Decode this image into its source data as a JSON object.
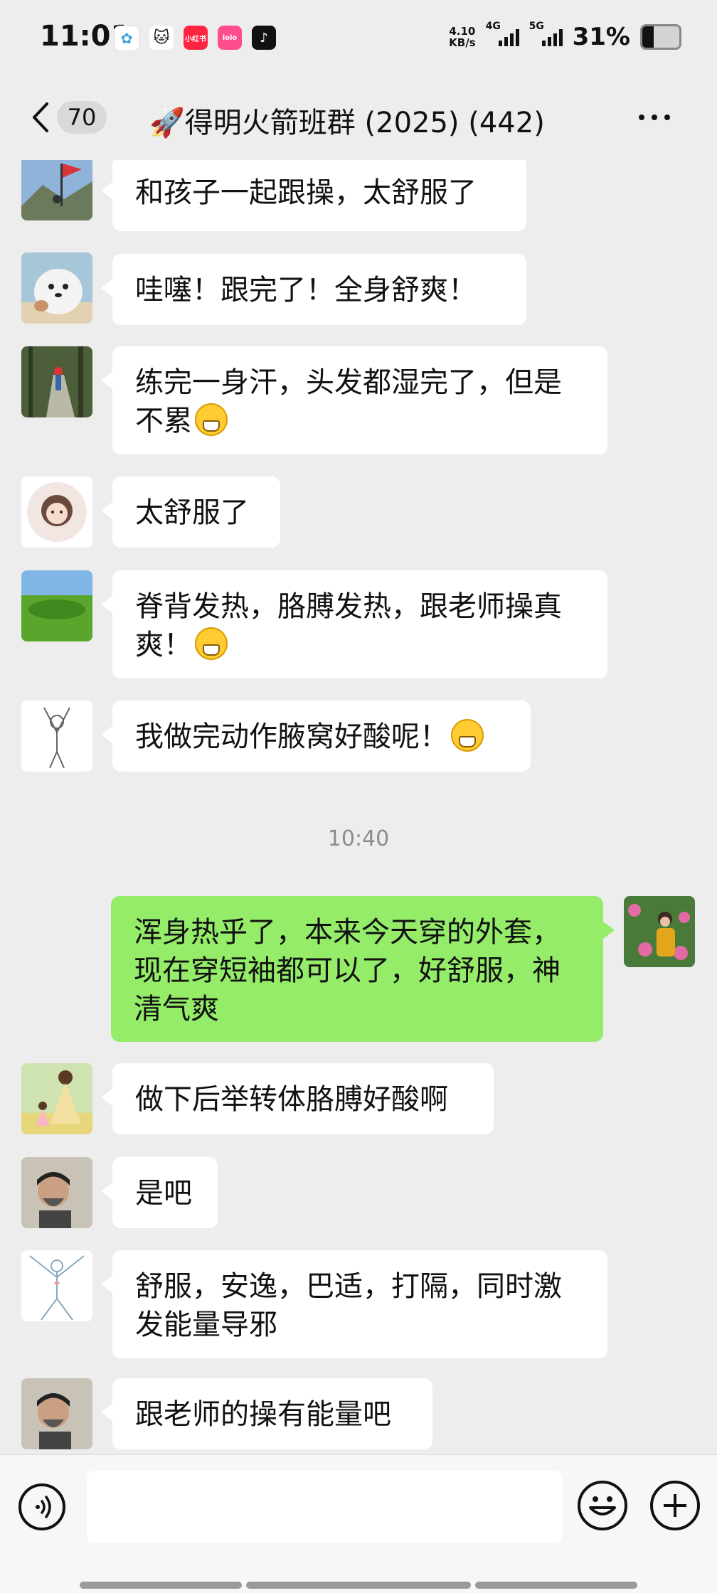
{
  "status_bar": {
    "time": "11:01",
    "net_speed_value": "4.10",
    "net_speed_unit": "KB/s",
    "signal1_label": "4G",
    "signal2_label": "5G",
    "battery_pct": "31%",
    "battery_level": 0.31,
    "app_icons": [
      "cloud-app-icon",
      "cat-app-icon",
      "xiaohongshu-app-icon",
      "pink-app-icon",
      "tiktok-app-icon"
    ],
    "xhs_label": "小红书",
    "pink_label": "lolo",
    "tiktok_label": "♪"
  },
  "nav": {
    "unread_count": "70",
    "title": "🚀得明火箭班群 (2025) (442)"
  },
  "messages": [
    {
      "side": "left",
      "text": "和孩子一起跟操，太舒服了",
      "avatar": "mountain-flag-avatar"
    },
    {
      "side": "left",
      "text": "哇噻！跟完了！全身舒爽！",
      "avatar": "seal-avatar"
    },
    {
      "side": "left",
      "text": "练完一身汗，头发都湿完了，但是不累",
      "emoji": true,
      "avatar": "forest-path-avatar"
    },
    {
      "side": "left",
      "text": "太舒服了",
      "avatar": "cartoon-girl-avatar"
    },
    {
      "side": "left",
      "text": "脊背发热，胳膊发热，跟老师操真爽！",
      "emoji": true,
      "avatar": "green-field-avatar"
    },
    {
      "side": "left",
      "text": "我做完动作腋窝好酸呢！",
      "emoji": true,
      "avatar": "sketch-figure-avatar"
    },
    {
      "side": "right",
      "text": "浑身热乎了，本来今天穿的外套，现在穿短袖都可以了，好舒服，神清气爽",
      "avatar": "flowers-woman-avatar"
    },
    {
      "side": "left",
      "text": "做下后举转体胳膊好酸啊",
      "avatar": "illustrated-girl-avatar"
    },
    {
      "side": "left",
      "text": "是吧",
      "avatar": "man-headscarf-avatar"
    },
    {
      "side": "left",
      "text": "舒服，安逸，巴适，打隔，同时激发能量导邪",
      "avatar": "stretch-figure-avatar"
    },
    {
      "side": "left",
      "text": "跟老师的操有能量吧",
      "avatar": "man-headscarf-avatar"
    }
  ],
  "timestamp": "10:40",
  "colors": {
    "background": "#ededed",
    "self_bubble": "#95ec69",
    "other_bubble": "#ffffff"
  }
}
